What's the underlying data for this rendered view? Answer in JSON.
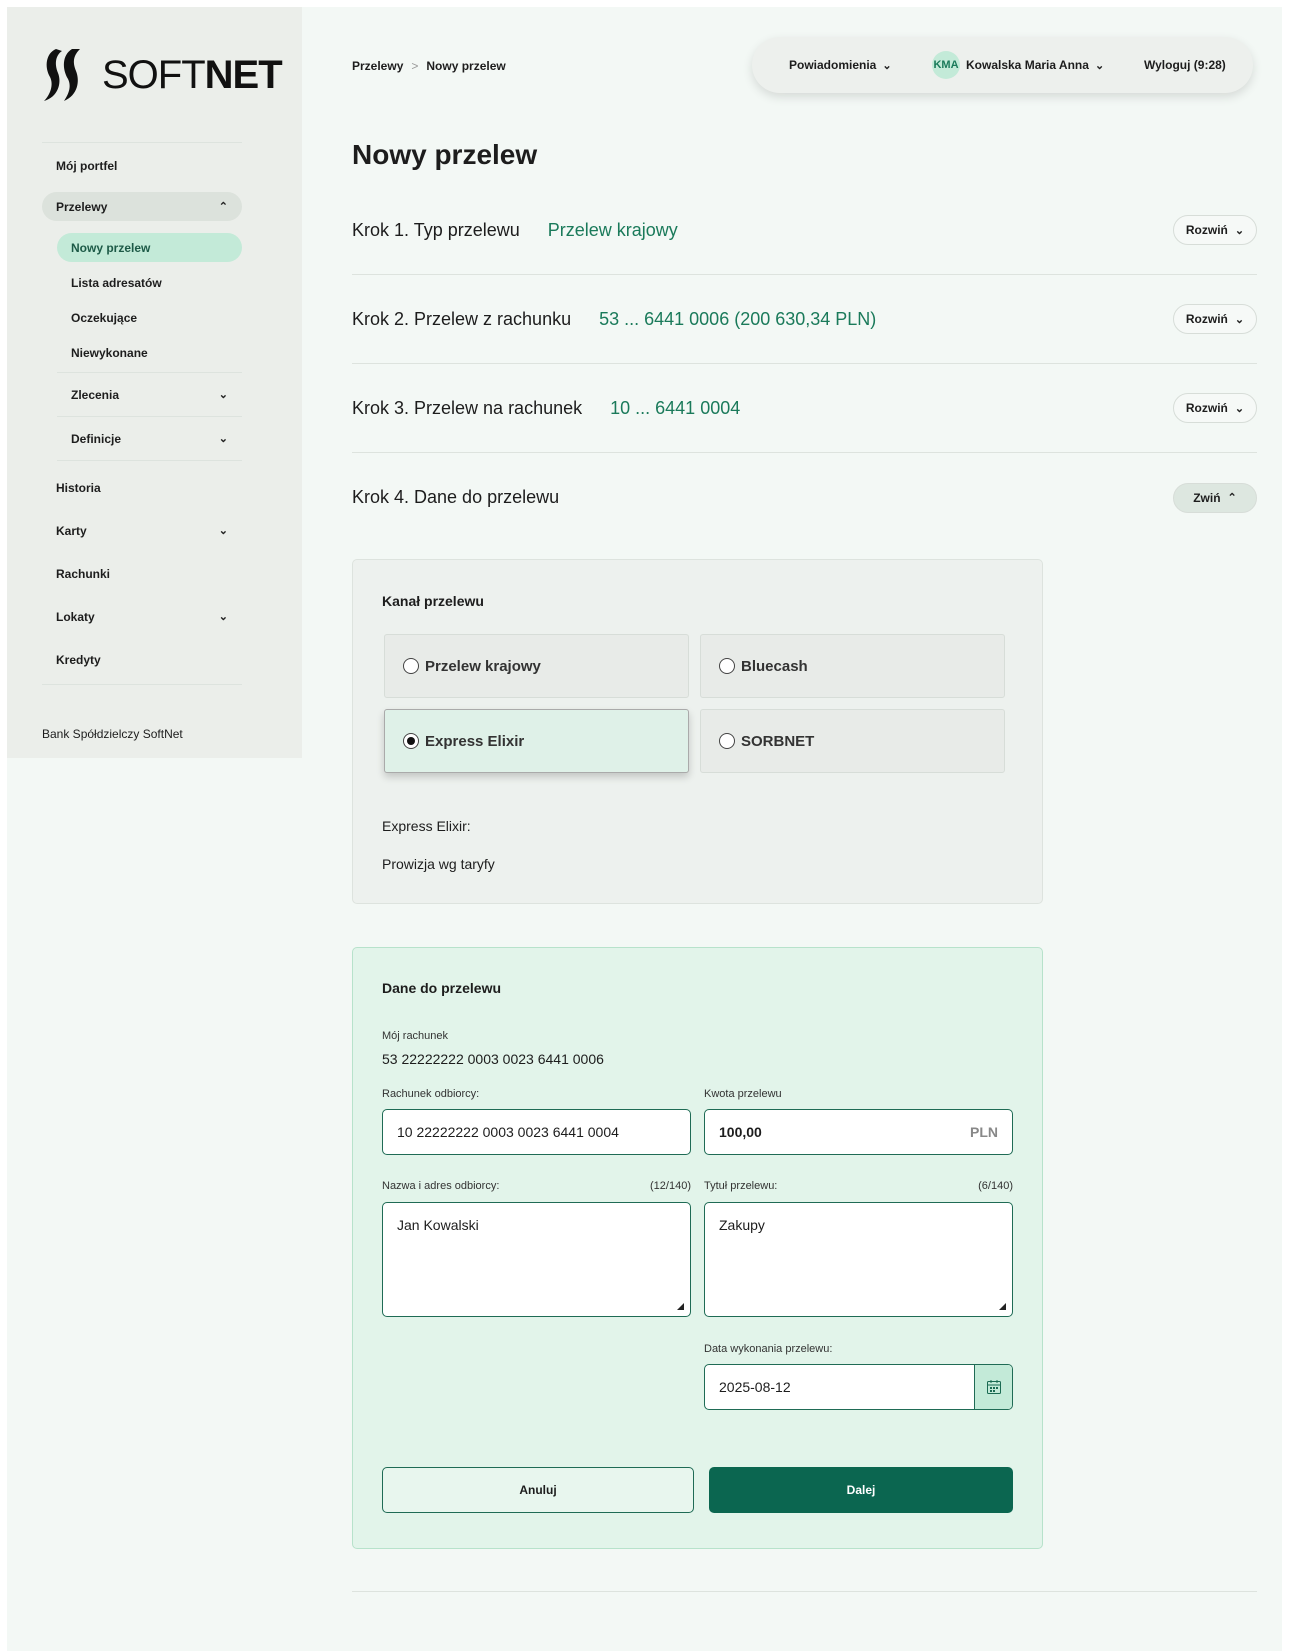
{
  "brand": {
    "logo_text_light": "SOFT",
    "logo_text_bold": "NET",
    "footer": "Bank Spółdzielczy SoftNet"
  },
  "sidebar": {
    "items": [
      {
        "label": "Mój portfel"
      },
      {
        "label": "Przelewy"
      },
      {
        "label": "Historia"
      },
      {
        "label": "Karty"
      },
      {
        "label": "Rachunki"
      },
      {
        "label": "Lokaty"
      },
      {
        "label": "Kredyty"
      }
    ],
    "subitems": [
      {
        "label": "Nowy przelew"
      },
      {
        "label": "Lista adresatów"
      },
      {
        "label": "Oczekujące"
      },
      {
        "label": "Niewykonane"
      }
    ],
    "subgroups": [
      {
        "label": "Zlecenia"
      },
      {
        "label": "Definicje"
      }
    ]
  },
  "breadcrumb": {
    "parent": "Przelewy",
    "sep": ">",
    "current": "Nowy przelew"
  },
  "topbar": {
    "notifications": "Powiadomienia",
    "initials": "KMA",
    "user": "Kowalska Maria Anna",
    "logout": "Wyloguj (9:28)"
  },
  "page": {
    "title": "Nowy przelew"
  },
  "steps": [
    {
      "title": "Krok 1. Typ przelewu",
      "value": "Przelew krajowy",
      "button": "Rozwiń"
    },
    {
      "title": "Krok 2. Przelew z rachunku",
      "value": "53 ... 6441 0006 (200 630,34 PLN)",
      "button": "Rozwiń"
    },
    {
      "title": "Krok 3. Przelew na rachunek",
      "value": "10 ... 6441 0004",
      "button": "Rozwiń"
    },
    {
      "title": "Krok 4. Dane do przelewu",
      "value": "",
      "button": "Zwiń"
    }
  ],
  "channel": {
    "heading": "Kanał przelewu",
    "options": [
      {
        "label": "Przelew krajowy",
        "selected": false
      },
      {
        "label": "Bluecash",
        "selected": false
      },
      {
        "label": "Express Elixir",
        "selected": true
      },
      {
        "label": "SORBNET",
        "selected": false
      }
    ],
    "info_title": "Express Elixir:",
    "info_text": "Prowizja wg taryfy"
  },
  "form": {
    "heading": "Dane do przelewu",
    "my_account_label": "Mój rachunek",
    "my_account": "53 22222222 0003 0023 6441 0006",
    "recipient_account_label": "Rachunek odbiorcy:",
    "recipient_account": "10 22222222 0003 0023 6441 0004",
    "amount_label": "Kwota przelewu",
    "amount": "100,00",
    "currency": "PLN",
    "recipient_name_label": "Nazwa i adres odbiorcy:",
    "recipient_name_count": "(12/140)",
    "recipient_name": "Jan Kowalski",
    "title_label": "Tytuł przelewu:",
    "title_count": "(6/140)",
    "title": "Zakupy",
    "date_label": "Data wykonania przelewu:",
    "date": "2025-08-12",
    "cancel": "Anuluj",
    "next": "Dalej"
  },
  "colors": {
    "accent": "#1a7a5a",
    "primary_button": "#0b6650",
    "active_nav": "#c3ead8"
  }
}
